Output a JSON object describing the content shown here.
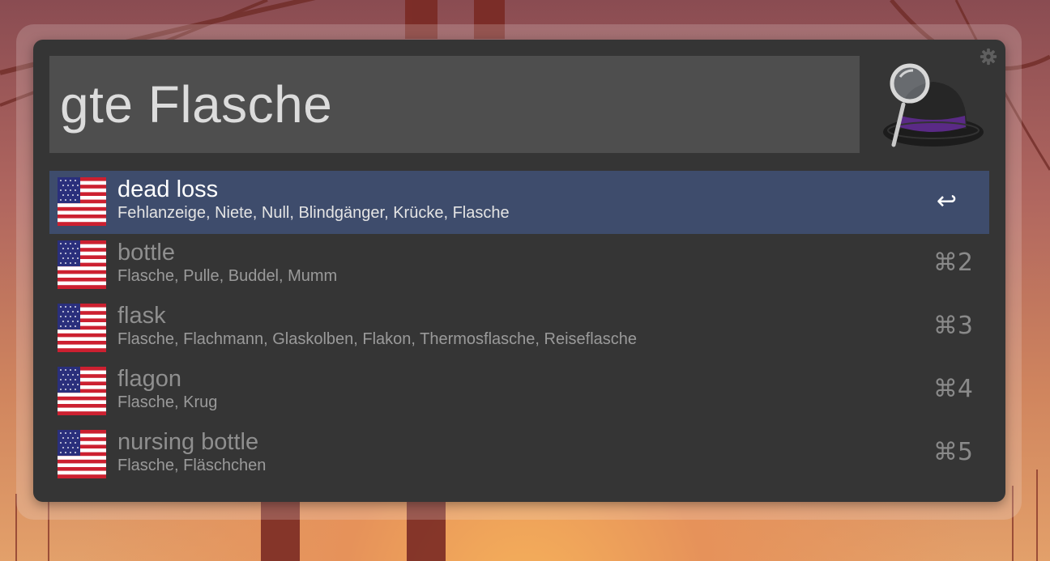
{
  "search": {
    "query": "gte Flasche"
  },
  "results": [
    {
      "title": "dead loss",
      "subtitle": "Fehlanzeige, Niete, Null, Blindgänger, Krücke, Flasche",
      "shortcut": "↩",
      "selected": true
    },
    {
      "title": "bottle",
      "subtitle": "Flasche, Pulle, Buddel, Mumm",
      "shortcut": "⌘2",
      "selected": false
    },
    {
      "title": "flask",
      "subtitle": "Flasche, Flachmann, Glaskolben, Flakon, Thermosflasche, Reiseflasche",
      "shortcut": "⌘3",
      "selected": false
    },
    {
      "title": "flagon",
      "subtitle": "Flasche, Krug",
      "shortcut": "⌘4",
      "selected": false
    },
    {
      "title": "nursing bottle",
      "subtitle": "Flasche, Fläschchen",
      "shortcut": "⌘5",
      "selected": false
    }
  ],
  "icons": {
    "result": "us-flag-icon",
    "logo": "alfred-hat-icon",
    "settings": "gear-icon"
  },
  "colors": {
    "panel": "#353535",
    "search_field": "#4e4e4e",
    "selection": "#3e4c6c"
  }
}
